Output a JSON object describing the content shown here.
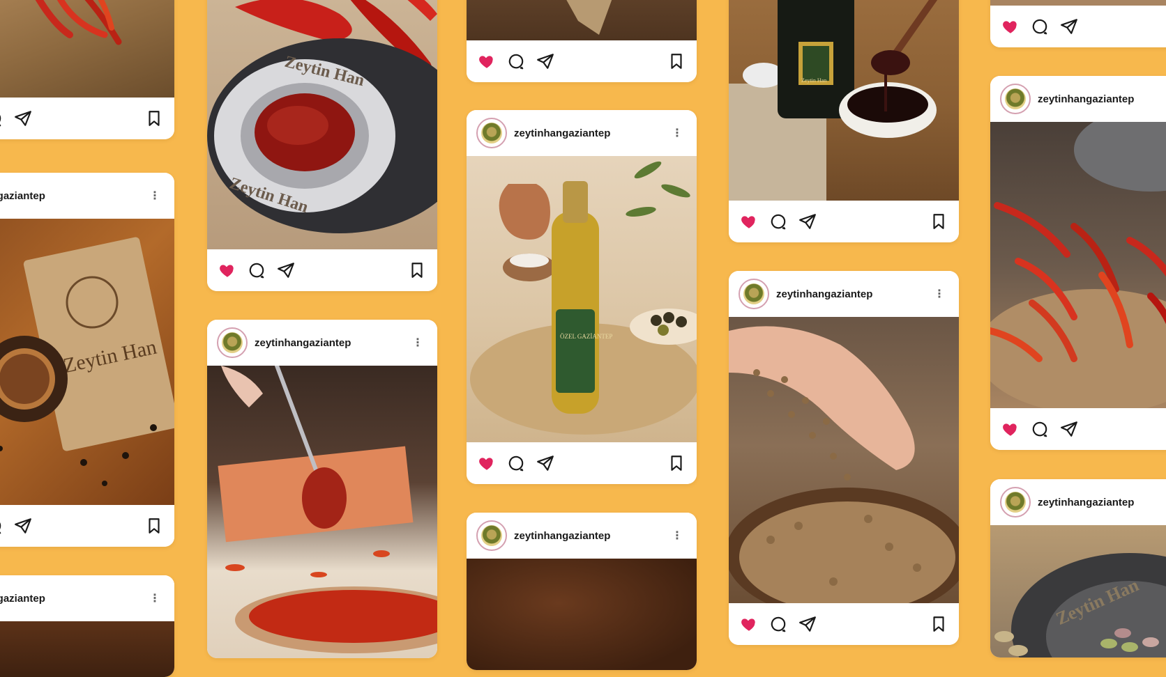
{
  "colors": {
    "background": "#F7B84D",
    "card": "#FFFFFF",
    "like": "#E0245E",
    "icon_stroke": "#1A1A1A"
  },
  "account": {
    "username": "zeytinhangaziantep",
    "username_cropped": "eytinhangaziantep",
    "more_icon": "more-vertical-icon"
  },
  "photo_labels": {
    "plate_brand": "Zeytin Han",
    "bag_brand": "Zeytin Han",
    "bottle_brand": "ÖZEL GAZİANTEP",
    "jar_brand": "Zeytin Han"
  },
  "actions": {
    "like_icon": "heart-filled-icon",
    "comment_icon": "comment-icon",
    "share_icon": "send-icon",
    "save_icon": "bookmark-icon"
  }
}
